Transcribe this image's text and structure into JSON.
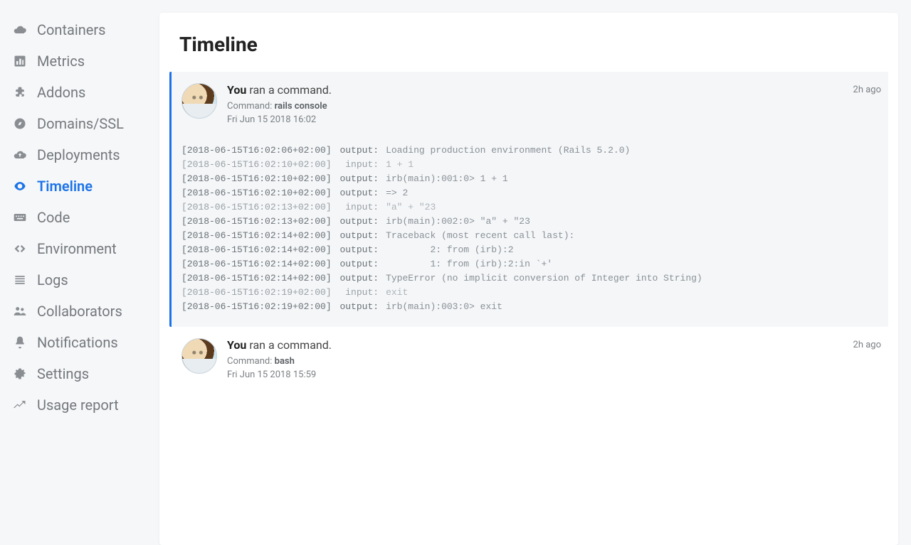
{
  "page": {
    "title": "Timeline"
  },
  "sidebar": {
    "items": [
      {
        "label": "Containers",
        "icon": "cloud"
      },
      {
        "label": "Metrics",
        "icon": "bar-chart"
      },
      {
        "label": "Addons",
        "icon": "puzzle"
      },
      {
        "label": "Domains/SSL",
        "icon": "compass"
      },
      {
        "label": "Deployments",
        "icon": "cloud-up"
      },
      {
        "label": "Timeline",
        "icon": "eye",
        "active": true
      },
      {
        "label": "Code",
        "icon": "keyboard"
      },
      {
        "label": "Environment",
        "icon": "angle-brackets"
      },
      {
        "label": "Logs",
        "icon": "lines"
      },
      {
        "label": "Collaborators",
        "icon": "people"
      },
      {
        "label": "Notifications",
        "icon": "bell"
      },
      {
        "label": "Settings",
        "icon": "gear"
      },
      {
        "label": "Usage report",
        "icon": "trend"
      }
    ]
  },
  "events": [
    {
      "who": "You",
      "action": "ran a command.",
      "command_prefix": "Command: ",
      "command": "rails console",
      "timestamp": "Fri Jun 15 2018 16:02",
      "relative": "2h ago",
      "expanded": true,
      "log": [
        {
          "ts": "[2018-06-15T16:02:06+02:00]",
          "kind": "output",
          "text": "Loading production environment (Rails 5.2.0)"
        },
        {
          "ts": "[2018-06-15T16:02:10+02:00]",
          "kind": "input",
          "text": "1 + 1"
        },
        {
          "ts": "[2018-06-15T16:02:10+02:00]",
          "kind": "output",
          "text": "irb(main):001:0> 1 + 1"
        },
        {
          "ts": "[2018-06-15T16:02:10+02:00]",
          "kind": "output",
          "text": "=> 2"
        },
        {
          "ts": "[2018-06-15T16:02:13+02:00]",
          "kind": "input",
          "text": "\"a\" + \"23"
        },
        {
          "ts": "[2018-06-15T16:02:13+02:00]",
          "kind": "output",
          "text": "irb(main):002:0> \"a\" + \"23"
        },
        {
          "ts": "[2018-06-15T16:02:14+02:00]",
          "kind": "output",
          "text": "Traceback (most recent call last):"
        },
        {
          "ts": "[2018-06-15T16:02:14+02:00]",
          "kind": "output",
          "text": "        2: from (irb):2"
        },
        {
          "ts": "[2018-06-15T16:02:14+02:00]",
          "kind": "output",
          "text": "        1: from (irb):2:in `+'"
        },
        {
          "ts": "[2018-06-15T16:02:14+02:00]",
          "kind": "output",
          "text": "TypeError (no implicit conversion of Integer into String)"
        },
        {
          "ts": "[2018-06-15T16:02:19+02:00]",
          "kind": "input",
          "text": "exit"
        },
        {
          "ts": "[2018-06-15T16:02:19+02:00]",
          "kind": "output",
          "text": "irb(main):003:0> exit"
        }
      ]
    },
    {
      "who": "You",
      "action": "ran a command.",
      "command_prefix": "Command: ",
      "command": "bash",
      "timestamp": "Fri Jun 15 2018 15:59",
      "relative": "2h ago",
      "expanded": false
    }
  ],
  "labels": {
    "input": " input:",
    "output": "output:"
  }
}
